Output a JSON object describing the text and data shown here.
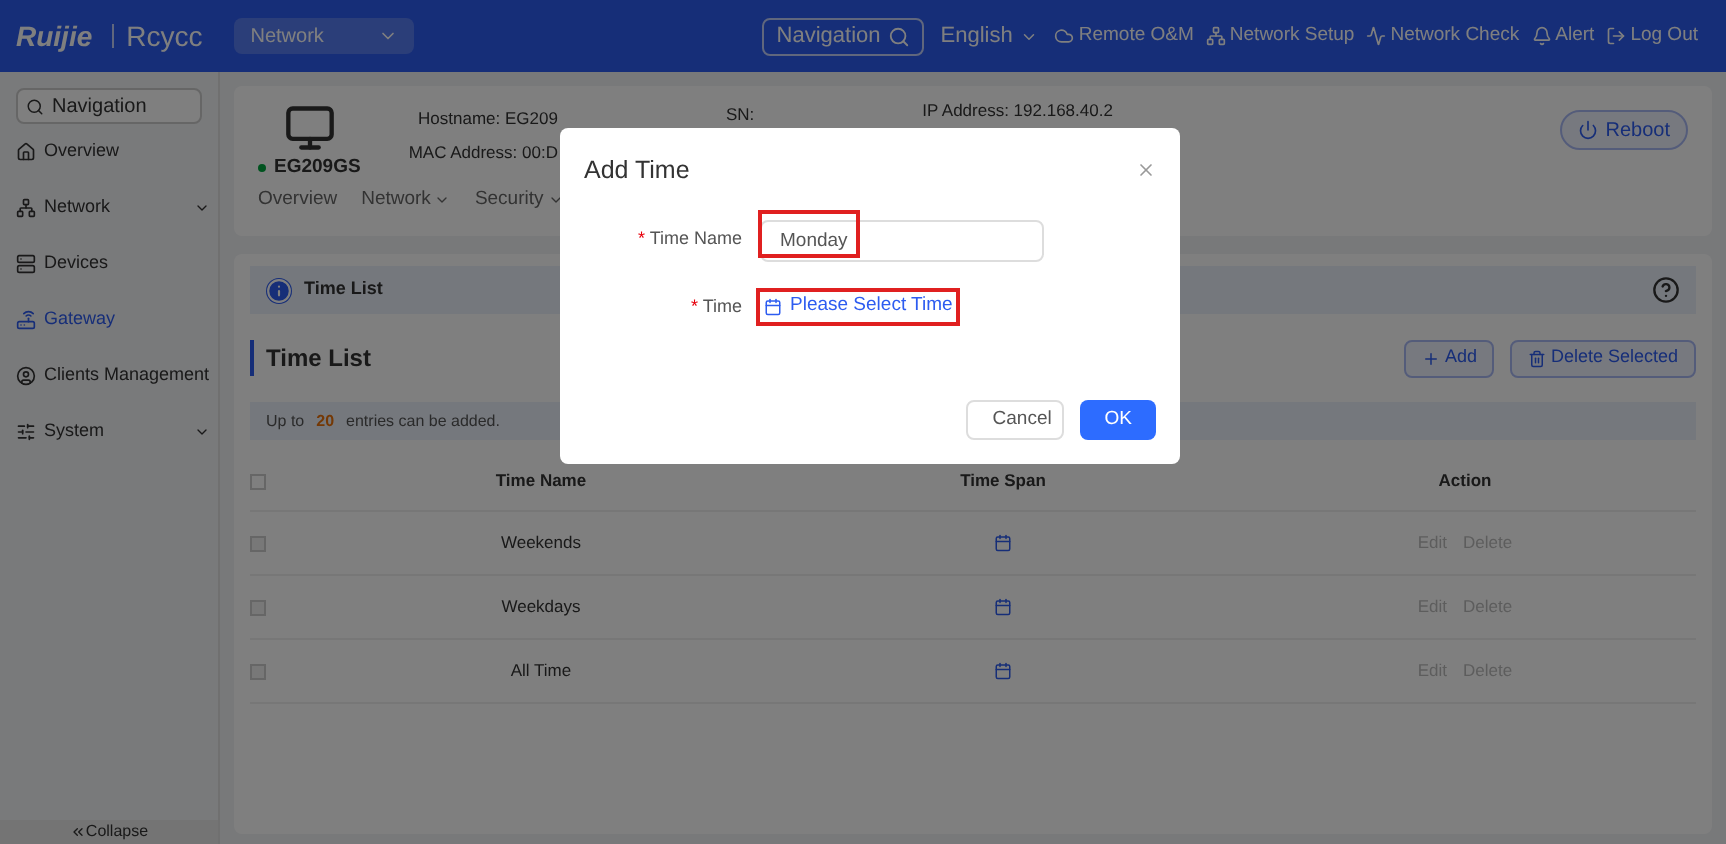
{
  "topbar": {
    "logo": "Ruijie",
    "brand": "Rcycc",
    "project": "Network",
    "search": "Navigation",
    "language": "English",
    "links": [
      "Remote O&M",
      "Network Setup",
      "Network Check",
      "Alert",
      "Log Out"
    ]
  },
  "sidebar": {
    "search": "Navigation",
    "items": [
      {
        "label": "Overview",
        "selected": false,
        "expandable": false
      },
      {
        "label": "Network",
        "selected": false,
        "expandable": true
      },
      {
        "label": "Devices",
        "selected": false,
        "expandable": false
      },
      {
        "label": "Gateway",
        "selected": true,
        "expandable": false
      },
      {
        "label": "Clients Management",
        "selected": false,
        "expandable": false
      },
      {
        "label": "System",
        "selected": false,
        "expandable": true
      }
    ],
    "collapse": "Collapse"
  },
  "device": {
    "model": "EG209GS",
    "hostname": "Hostname: EG209",
    "mac": "MAC Address: 00:D",
    "sn": "SN:",
    "ip": "IP Address: 192.168.40.2",
    "reboot": "Reboot",
    "tabs": [
      {
        "label": "Overview",
        "dropdown": false
      },
      {
        "label": "Network",
        "dropdown": true
      },
      {
        "label": "Security",
        "dropdown": true
      }
    ]
  },
  "info_bar": "Time List",
  "section": {
    "title": "Time List",
    "add": "Add",
    "delete": "Delete Selected",
    "notice": {
      "before": "Up to",
      "count": "20",
      "after": "entries can be added."
    }
  },
  "table": {
    "select_all_checked": false,
    "columns": [
      "Time Name",
      "Time Span",
      "Action"
    ],
    "rows": [
      {
        "checked": false,
        "name": "Weekends",
        "actions": [
          "Edit",
          "Delete"
        ]
      },
      {
        "checked": false,
        "name": "Weekdays",
        "actions": [
          "Edit",
          "Delete"
        ]
      },
      {
        "checked": false,
        "name": "All Time",
        "actions": [
          "Edit",
          "Delete"
        ]
      }
    ]
  },
  "dialog": {
    "title": "Add Time",
    "fields": [
      {
        "required_mark": "*",
        "label": "Time Name",
        "kind": "input",
        "value": "Monday"
      },
      {
        "required_mark": "*",
        "label": "Time",
        "kind": "picker",
        "value": "Please Select Time"
      }
    ],
    "buttons": [
      {
        "label": "Cancel",
        "primary": false
      },
      {
        "label": "OK",
        "primary": true
      }
    ]
  }
}
